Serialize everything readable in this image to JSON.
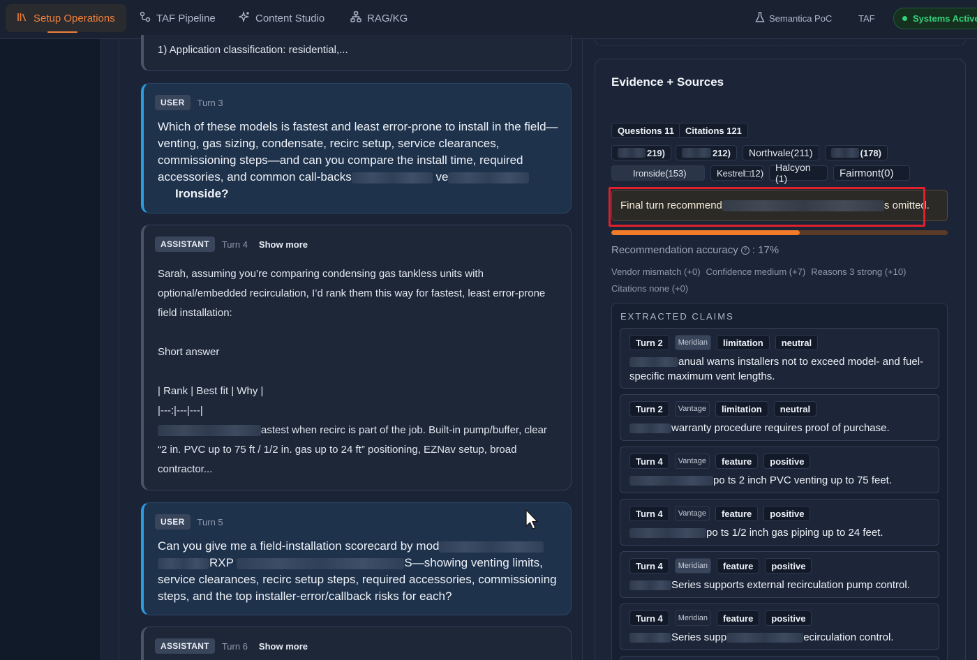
{
  "nav": {
    "tabs": [
      {
        "label": "Setup Operations",
        "icon": "library-icon",
        "active": true
      },
      {
        "label": "TAF Pipeline",
        "icon": "pipeline-icon"
      },
      {
        "label": "Content Studio",
        "icon": "sparkle-icon"
      },
      {
        "label": "RAG/KG",
        "icon": "graph-icon"
      }
    ],
    "right": {
      "semantica": "Semantica PoC",
      "taf": "TAF",
      "status": "Systems Active"
    },
    "accent": "#f0803c"
  },
  "chat": {
    "prev_assistant_tail": "1) Application classification: residential,...",
    "messages": [
      {
        "role": "USER",
        "turn": "Turn 3",
        "lines": [
          "Which of these models is fastest and least error-prone to install in the field—",
          "venting, gas sizing, condensate, recirc setup, service clearances,",
          "commissioning steps—and can you compare the install time, required",
          "accessories, and common call-backs",
          "ve",
          "Ironside?"
        ]
      },
      {
        "role": "ASSISTANT",
        "turn": "Turn 4",
        "show_more": "Show more",
        "lines": [
          "Sarah, assuming you’re comparing condensing gas tankless units with",
          "optional/embedded recirculation, I’d rank them this way for fastest, least error-prone",
          "field installation:",
          "Short answer",
          "| Rank | Best fit | Why |",
          "|---:|---|---|",
          "astest when recirc is part of the job. Built-in pump/buffer, clear",
          "“2 in. PVC up to 75 ft / 1/2 in. gas up to 24 ft” positioning, EZNav setup, broad",
          "contractor..."
        ]
      },
      {
        "role": "USER",
        "turn": "Turn 5",
        "lines": [
          "Can you give me a field-installation scorecard by mod",
          "RXP",
          "S—showing venting limits,",
          "service clearances, recirc setup steps, required accessories, commissioning",
          "steps, and the top installer-error/callback risks for each?"
        ]
      },
      {
        "role": "ASSISTANT",
        "turn": "Turn 6",
        "show_more": "Show more"
      }
    ]
  },
  "evidence": {
    "title": "Evidence + Sources",
    "questions": "Questions 11",
    "citations": "Citations 121",
    "sources_row1": [
      "219)",
      "212)",
      "Northvale(211)",
      "(178)"
    ],
    "sources_row2": [
      "Ironside(153)",
      "Kestrel□12)",
      "Halcyon (1)",
      "Fairmont(0)"
    ],
    "alert_prefix": "Final turn recommend",
    "alert_suffix": "s omitted.",
    "accuracy_label": "Recommendation accuracy",
    "accuracy_value": ": 17%",
    "accuracy_fraction": 0.56,
    "scores_row1": [
      "Vendor mismatch (+0)",
      "Confidence medium (+7)",
      "Reasons 3 strong (+10)"
    ],
    "scores_row2": [
      "Citations none (+0)"
    ],
    "claims_title": "EXTRACTED CLAIMS",
    "claims": [
      {
        "turn": "Turn 2",
        "vendor": "Meridian",
        "type": "limitation",
        "sentiment": "neutral",
        "text1": "anual warns installers not to exceed model- and fuel-",
        "text2": "specific maximum vent lengths."
      },
      {
        "turn": "Turn 2",
        "vendor": "Vantage",
        "type": "limitation",
        "sentiment": "neutral",
        "text1": "warranty procedure requires proof of purchase.",
        "text2": ""
      },
      {
        "turn": "Turn 4",
        "vendor": "Vantage",
        "type": "feature",
        "sentiment": "positive",
        "text1": "ts 2 inch PVC venting up to 75 feet.",
        "pre": "po",
        "text2": ""
      },
      {
        "turn": "Turn 4",
        "vendor": "Vantage",
        "type": "feature",
        "sentiment": "positive",
        "text1": "ts 1/2 inch gas piping up to 24 feet.",
        "pre": "po",
        "text2": ""
      },
      {
        "turn": "Turn 4",
        "vendor": "Meridian",
        "type": "feature",
        "sentiment": "positive",
        "text1": "Series supports external recirculation pump control.",
        "text2": ""
      },
      {
        "turn": "Turn 4",
        "vendor": "Meridian",
        "type": "feature",
        "sentiment": "positive",
        "text1": "Series supp",
        "text1b": "ecirculation control.",
        "text2": ""
      }
    ]
  }
}
